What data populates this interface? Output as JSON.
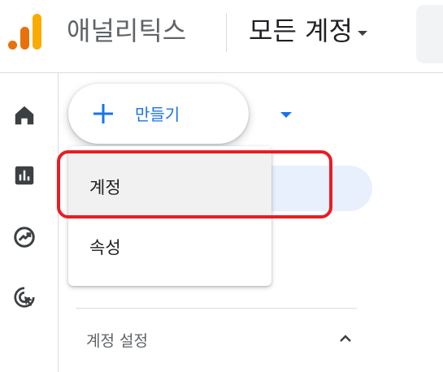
{
  "header": {
    "app_name": "애널리틱스",
    "account_selector": "모든 계정"
  },
  "brand_colors": {
    "logo_dark": "#e8710a",
    "logo_light": "#f9ab00",
    "accent": "#1a73e8",
    "annotation": "#ea1c24"
  },
  "nav": {
    "icons": [
      "home-icon",
      "reports-icon",
      "explore-icon",
      "advertising-icon"
    ]
  },
  "create_button": {
    "label": "만들기",
    "icon": "plus-icon"
  },
  "create_menu": {
    "items": [
      "계정",
      "속성"
    ],
    "highlighted_index": 0
  },
  "section": {
    "label": "계정 설정",
    "icon": "chevron-up-icon"
  }
}
